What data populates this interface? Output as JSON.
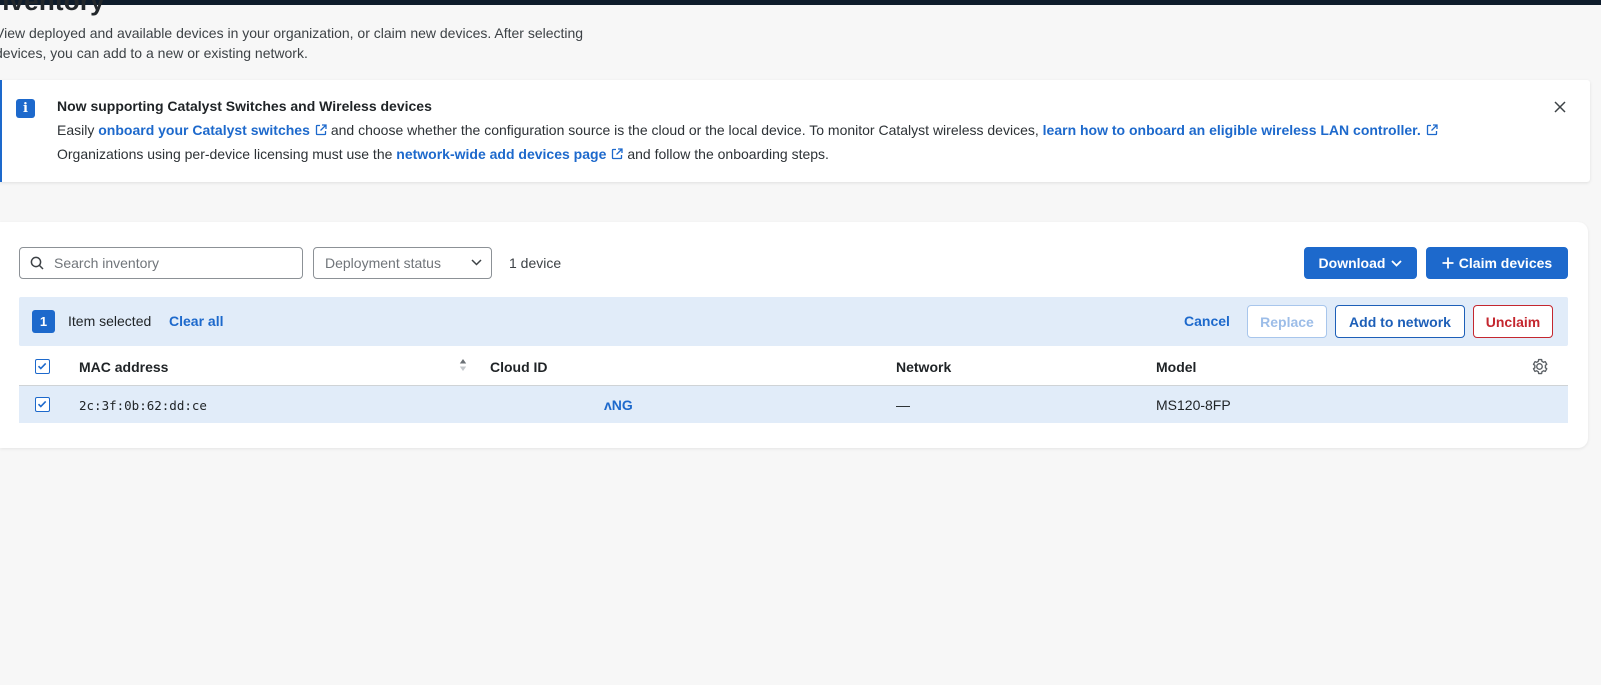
{
  "page": {
    "title": "Inventory",
    "description": "View deployed and available devices in your organization, or claim new devices. After selecting devices, you can add to a new or existing network."
  },
  "banner": {
    "title": "Now supporting Catalyst Switches and Wireless devices",
    "line1_prefix": "Easily",
    "line1_link1": "onboard your Catalyst switches",
    "line1_middle": "and choose whether the configuration source is the cloud or the local device. To monitor Catalyst wireless devices,",
    "line1_link2": "learn how to onboard an eligible wireless LAN controller.",
    "line2_prefix": "Organizations using per-device licensing must use the",
    "line2_link": "network-wide add devices page",
    "line2_suffix": "and follow the onboarding steps."
  },
  "toolbar": {
    "search_placeholder": "Search inventory",
    "search_value": "",
    "deployment_status_placeholder": "Deployment status",
    "device_count": "1 device",
    "download_label": "Download",
    "claim_label": "Claim devices"
  },
  "selection": {
    "count": "1",
    "label": "Item selected",
    "clear_all": "Clear all",
    "cancel": "Cancel",
    "replace": "Replace",
    "add_to_network": "Add to network",
    "unclaim": "Unclaim"
  },
  "table": {
    "columns": {
      "mac": "MAC address",
      "cloud_id": "Cloud ID",
      "network": "Network",
      "model": "Model"
    },
    "rows": [
      {
        "selected": true,
        "mac": "2c:3f:0b:62:dd:ce",
        "cloud_id": "ʌNG",
        "network": "—",
        "model": "MS120-8FP"
      }
    ]
  },
  "colors": {
    "primary": "#1d69cc",
    "danger": "#c4272f",
    "selection_bg": "#e1ecf9",
    "top_bar": "#0e1c2b"
  },
  "icons": {
    "banner": "info-icon",
    "external": "external-link-icon",
    "close": "close-icon",
    "search": "search-icon",
    "select": "chevron-down-icon",
    "claim": "plus-icon",
    "sort": "sort-icon",
    "settings": "gear-icon",
    "checkbox": "checkmark-icon"
  }
}
